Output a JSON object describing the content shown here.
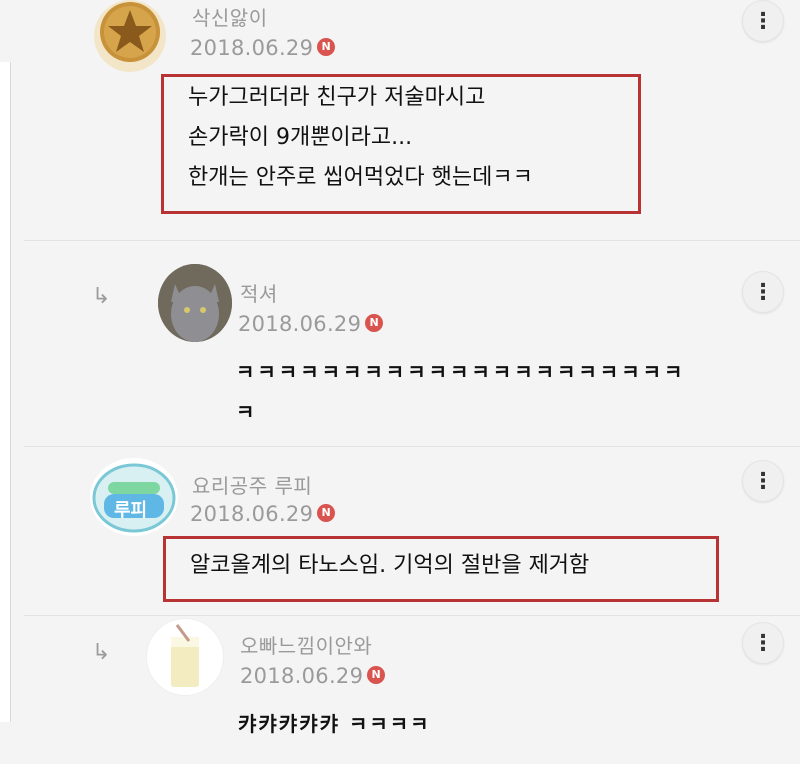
{
  "comments": [
    {
      "username": "삭신앓이",
      "date": "2018.06.29",
      "badge": "N",
      "lines": [
        "누가그러더라 친구가 저술마시고",
        "손가락이 9개뿐이라고...",
        "한개는 안주로 씹어먹었다 햇는데ㅋㅋ"
      ],
      "avatar_icon": "star-cookie-icon"
    },
    {
      "username": "적셔",
      "date": "2018.06.29",
      "badge": "N",
      "lines": [
        "ㅋㅋㅋㅋㅋㅋㅋㅋㅋㅋㅋㅋㅋㅋㅋㅋㅋㅋㅋㅋㅋ",
        "ㅋ"
      ],
      "avatar_icon": "cat-avatar-icon"
    },
    {
      "username": "요리공주 루피",
      "date": "2018.06.29",
      "badge": "N",
      "lines": [
        "알코올계의 타노스임. 기억의 절반을 제거함"
      ],
      "avatar_text": "루피",
      "avatar_icon": "loopy-logo-icon"
    },
    {
      "username": "오빠느낌이안와",
      "date": "2018.06.29",
      "badge": "N",
      "lines": [
        "캬캬캬캬캬 ㅋㅋㅋㅋ"
      ],
      "avatar_icon": "drink-glass-icon"
    }
  ],
  "more_label": "⋮",
  "reply_arrow": "↳",
  "colors": {
    "highlight": "#b83434",
    "badge": "#d9534f",
    "meta": "#9a9a9a"
  }
}
